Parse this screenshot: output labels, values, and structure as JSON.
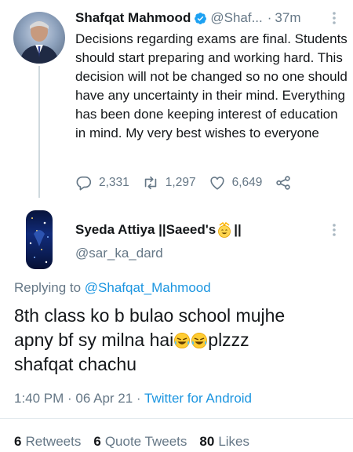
{
  "parent_tweet": {
    "author_name": "Shafqat Mahmood",
    "handle": "@Shaf...",
    "separator": "·",
    "time_ago": "37m",
    "text": "Decisions regarding exams are final. Students should start preparing and working hard. This decision will not be changed so no one should have any uncertainty in their mind. Everything has been done keeping interest of education in mind. My very best wishes to everyone",
    "reply_count": "2,331",
    "retweet_count": "1,297",
    "like_count": "6,649",
    "verified": true,
    "icons": [
      "reply-icon",
      "retweet-icon",
      "like-icon",
      "share-icon",
      "more-icon",
      "verified-badge-icon"
    ]
  },
  "reply_tweet": {
    "author_name": "Syeda Attiya ||Saeed's",
    "author_name_suffix": "||",
    "handle": "@sar_ka_dard",
    "replying_prefix": "Replying to",
    "replying_mention": "@Shafqat_Mahmood",
    "text_line1": "8th class ko b bulao school mujhe",
    "text_line2_a": "apny bf sy milna hai",
    "text_line2_b": "plzzz",
    "text_line3": "shafqat chachu",
    "timestamp": "1:40 PM · 06 Apr 21 · ",
    "source": "Twitter for Android",
    "icons": [
      "party-emoji-icon",
      "cry-laugh-emoji-icon",
      "more-icon"
    ]
  },
  "stats": {
    "retweets_count": "6",
    "retweets_label": "Retweets",
    "quote_count": "6",
    "quote_label": "Quote Tweets",
    "likes_count": "80",
    "likes_label": "Likes"
  },
  "colors": {
    "text": "#14171a",
    "secondary": "#657786",
    "link": "#1b95e0",
    "verified": "#1da1f2",
    "divider": "#e1e8ed"
  }
}
